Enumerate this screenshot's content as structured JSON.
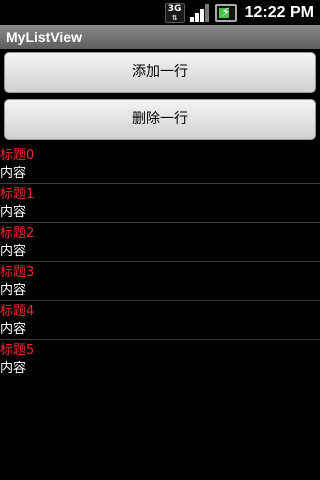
{
  "status_bar": {
    "network": "3G",
    "time": "12:22 PM",
    "icons": [
      "3g-icon",
      "signal-icon",
      "battery-charging-icon"
    ]
  },
  "app": {
    "title": "MyListView"
  },
  "buttons": {
    "add_label": "添加一行",
    "delete_label": "删除一行"
  },
  "list": {
    "items": [
      {
        "title": "标题0",
        "content": "内容"
      },
      {
        "title": "标题1",
        "content": "内容"
      },
      {
        "title": "标题2",
        "content": "内容"
      },
      {
        "title": "标题3",
        "content": "内容"
      },
      {
        "title": "标题4",
        "content": "内容"
      },
      {
        "title": "标题5",
        "content": "内容"
      }
    ]
  },
  "colors": {
    "title_text": "#e82c2c",
    "content_text": "#ffffff",
    "background": "#000000"
  }
}
